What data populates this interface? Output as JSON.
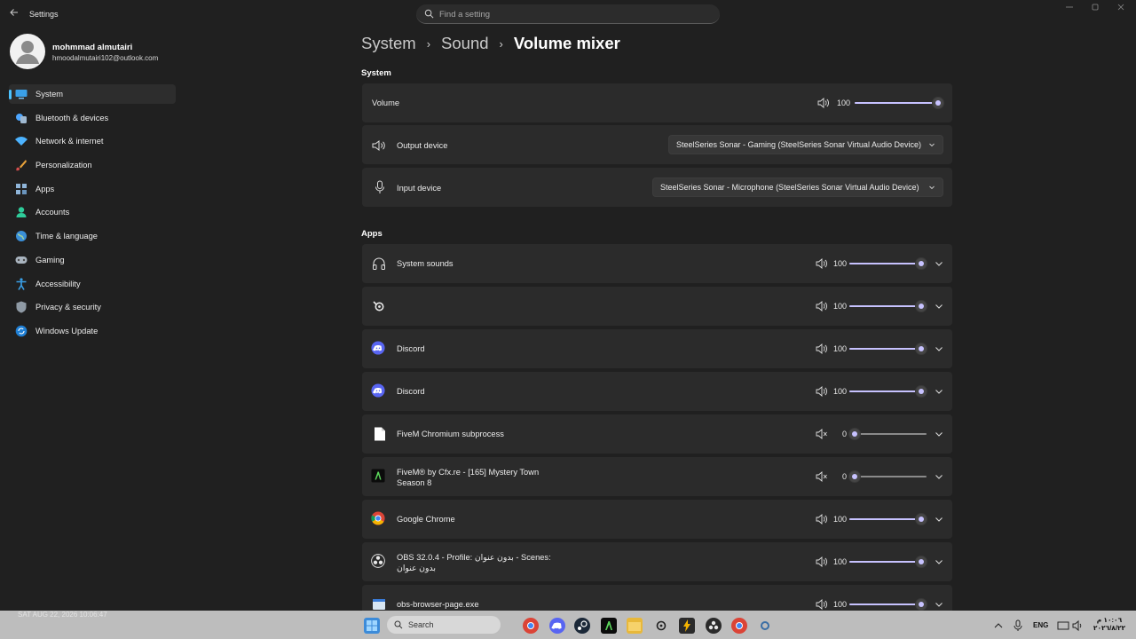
{
  "app": {
    "title": "Settings"
  },
  "search": {
    "placeholder": "Find a setting"
  },
  "user": {
    "name": "mohmmad almutairi",
    "email": "hmoodalmutairi102@outlook.com"
  },
  "nav": [
    {
      "label": "System",
      "icon": "monitor-icon",
      "active": true
    },
    {
      "label": "Bluetooth & devices",
      "icon": "bluetooth-icon"
    },
    {
      "label": "Network & internet",
      "icon": "wifi-icon"
    },
    {
      "label": "Personalization",
      "icon": "brush-icon"
    },
    {
      "label": "Apps",
      "icon": "apps-icon"
    },
    {
      "label": "Accounts",
      "icon": "person-icon"
    },
    {
      "label": "Time & language",
      "icon": "globe-icon"
    },
    {
      "label": "Gaming",
      "icon": "gamepad-icon"
    },
    {
      "label": "Accessibility",
      "icon": "accessibility-icon"
    },
    {
      "label": "Privacy & security",
      "icon": "shield-icon"
    },
    {
      "label": "Windows Update",
      "icon": "update-icon"
    }
  ],
  "breadcrumb": [
    "System",
    "Sound",
    "Volume mixer"
  ],
  "system_section": {
    "title": "System",
    "volume": {
      "label": "Volume",
      "value": "100",
      "level": 1.0
    },
    "output": {
      "label": "Output device",
      "value": "SteelSeries Sonar - Gaming (SteelSeries Sonar Virtual Audio Device)"
    },
    "input": {
      "label": "Input device",
      "value": "SteelSeries Sonar - Microphone (SteelSeries Sonar Virtual Audio Device)"
    }
  },
  "apps_section": {
    "title": "Apps",
    "apps": [
      {
        "name": "System sounds",
        "name2": "",
        "icon": "headphones-icon",
        "value": "100",
        "muted": false,
        "level": 1.0
      },
      {
        "name": "",
        "name2": "",
        "icon": "steelseries-icon",
        "value": "100",
        "muted": false,
        "level": 1.0
      },
      {
        "name": "Discord",
        "name2": "",
        "icon": "discord-icon",
        "value": "100",
        "muted": false,
        "level": 1.0
      },
      {
        "name": "Discord",
        "name2": "",
        "icon": "discord-icon",
        "value": "100",
        "muted": false,
        "level": 1.0
      },
      {
        "name": "FiveM Chromium subprocess",
        "name2": "",
        "icon": "file-icon",
        "value": "0",
        "muted": true,
        "level": 0.0
      },
      {
        "name": "FiveM® by Cfx.re - [165] Mystery Town",
        "name2": "Season 8",
        "icon": "fivem-icon",
        "value": "0",
        "muted": true,
        "level": 0.0
      },
      {
        "name": "Google Chrome",
        "name2": "",
        "icon": "chrome-icon",
        "value": "100",
        "muted": false,
        "level": 1.0
      },
      {
        "name": "OBS 32.0.4 - Profile: بدون عنوان - Scenes:",
        "name2": "بدون عنوان",
        "icon": "obs-icon",
        "value": "100",
        "muted": false,
        "level": 1.0
      },
      {
        "name": "obs-browser-page.exe",
        "name2": "",
        "icon": "app-window-icon",
        "value": "100",
        "muted": false,
        "level": 1.0
      }
    ]
  },
  "taskbar": {
    "timestamp": "SAT AUG 22, 2026 10:06:47",
    "search_label": "Search",
    "language": "ENG",
    "clock": "١٠:٠٦ م",
    "date": "٢٠٢٦/٨/٢٢"
  },
  "colors": {
    "accent": "#4cc2ff",
    "slider": "#c7c2ff",
    "card": "#2b2b2b",
    "background": "#202020"
  }
}
